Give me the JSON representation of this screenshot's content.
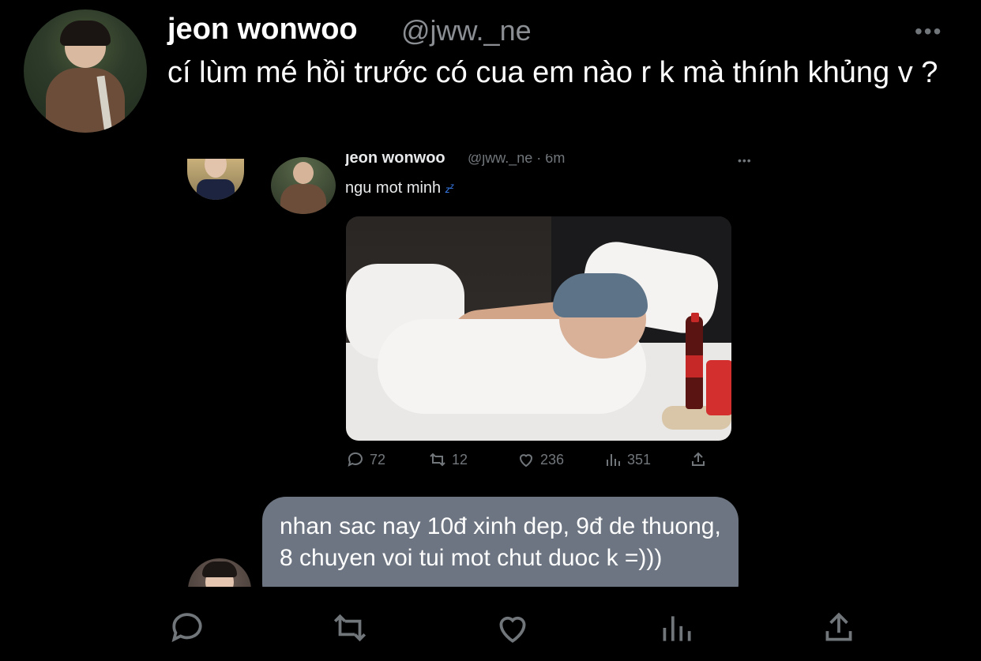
{
  "tweet": {
    "author_name": "jeon wonwoo",
    "author_handle": "@jww._ne",
    "text": "cí lùm mé hồi trước có cua em nào r k mà thính khủng v ?",
    "more_icon": "more-icon"
  },
  "embedded_screenshot": {
    "tweet": {
      "author_name": "jeon wonwoo",
      "author_handle_time": "@jww._ne · 6m",
      "text": "ngu mot minh",
      "emoji": "zzz",
      "stats": {
        "replies": "72",
        "retweets": "12",
        "likes": "236",
        "views": "351"
      }
    },
    "reply_text": "nhan sac nay 10đ xinh dep, 9đ de thuong, 8 chuyen voi tui mot chut duoc k =)))"
  },
  "actions": {
    "icons": [
      "reply-icon",
      "retweet-icon",
      "like-icon",
      "views-icon",
      "share-icon"
    ]
  },
  "colors": {
    "background": "#000000",
    "text_primary": "#ffffff",
    "text_secondary": "#71767b",
    "bubble": "#6c7581",
    "zzz": "#3b82f6"
  }
}
